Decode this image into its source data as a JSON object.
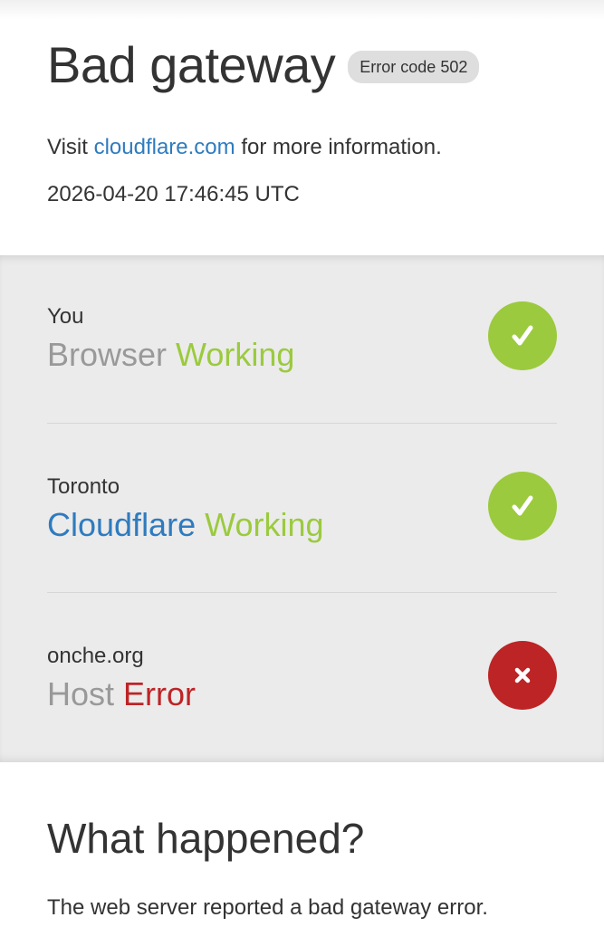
{
  "header": {
    "title": "Bad gateway",
    "error_badge": "Error code 502",
    "info_prefix": "Visit ",
    "info_link": "cloudflare.com",
    "info_suffix": " for more information.",
    "timestamp": "2026-04-20 17:46:45 UTC"
  },
  "status": {
    "rows": [
      {
        "location": "You",
        "service": "Browser",
        "state": "Working",
        "ok": true
      },
      {
        "location": "Toronto",
        "service": "Cloudflare",
        "state": "Working",
        "ok": true
      },
      {
        "location": "onche.org",
        "service": "Host",
        "state": "Error",
        "ok": false
      }
    ]
  },
  "what_happened": {
    "title": "What happened?",
    "text": "The web server reported a bad gateway error."
  },
  "colors": {
    "link_blue": "#2f7bbf",
    "ok_green": "#9bca3e",
    "error_red": "#bd2426",
    "panel_gray": "#ebebeb"
  },
  "icons": {
    "ok": "checkmark-icon",
    "error": "x-icon"
  }
}
